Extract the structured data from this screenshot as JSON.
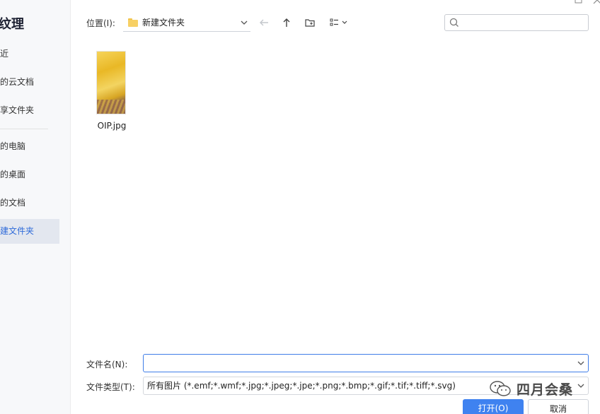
{
  "sidebar": {
    "title": "纹理",
    "items": [
      {
        "label": "近",
        "active": false
      },
      {
        "label": "的云文档",
        "active": false
      },
      {
        "label": "享文件夹",
        "active": false
      },
      {
        "label": "的电脑",
        "active": false
      },
      {
        "label": "的桌面",
        "active": false
      },
      {
        "label": "的文档",
        "active": false
      },
      {
        "label": "建文件夹",
        "active": true
      }
    ]
  },
  "toolbar": {
    "location_label": "位置(I):",
    "location_value": "新建文件夹",
    "search_placeholder": ""
  },
  "files": [
    {
      "name": "OIP.jpg"
    }
  ],
  "footer": {
    "filename_label": "文件名(N):",
    "filename_value": "",
    "filetype_label": "文件类型(T):",
    "filetype_value": "所有图片 (*.emf;*.wmf;*.jpg;*.jpeg;*.jpe;*.png;*.bmp;*.gif;*.tif;*.tiff;*.svg)",
    "open_label": "打开(O)",
    "cancel_label": "取消"
  },
  "watermark": {
    "text": "四月会桑"
  },
  "colors": {
    "accent": "#3f82f0",
    "active_bg": "#e3e7ef",
    "active_text": "#2f6bd9"
  }
}
